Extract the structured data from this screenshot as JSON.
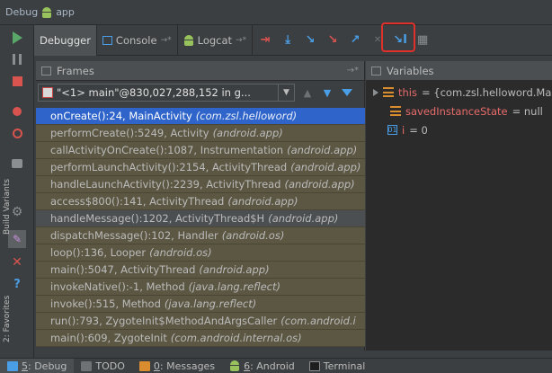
{
  "window": {
    "title": "Debug",
    "app_label": "app"
  },
  "toolbar": {
    "tabs": [
      {
        "label": "Debugger",
        "active": true
      },
      {
        "label": "Console",
        "pin": "→*"
      },
      {
        "label": "Logcat",
        "pin": "→*"
      }
    ],
    "buttons": [
      "show-execution-point-icon",
      "step-over-icon",
      "step-into-icon",
      "force-step-into-icon",
      "step-out-icon",
      "run-to-cursor-icon",
      "evaluate-icon"
    ]
  },
  "frames": {
    "title": "Frames",
    "pin": "→*",
    "thread_selector": "\"<1> main\"@830,027,288,152 in g...",
    "items": [
      {
        "method": "onCreate():24, MainActivity",
        "pkg": "(com.zsl.helloword)",
        "selected": true
      },
      {
        "method": "performCreate():5249, Activity",
        "pkg": "(android.app)"
      },
      {
        "method": "callActivityOnCreate():1087, Instrumentation",
        "pkg": "(android.app)"
      },
      {
        "method": "performLaunchActivity():2154, ActivityThread",
        "pkg": "(android.app)"
      },
      {
        "method": "handleLaunchActivity():2239, ActivityThread",
        "pkg": "(android.app)"
      },
      {
        "method": "access$800():141, ActivityThread",
        "pkg": "(android.app)"
      },
      {
        "method": "handleMessage():1202, ActivityThread$H",
        "pkg": "(android.app)",
        "grey": true
      },
      {
        "method": "dispatchMessage():102, Handler",
        "pkg": "(android.os)"
      },
      {
        "method": "loop():136, Looper",
        "pkg": "(android.os)"
      },
      {
        "method": "main():5047, ActivityThread",
        "pkg": "(android.app)"
      },
      {
        "method": "invokeNative():-1, Method",
        "pkg": "(java.lang.reflect)"
      },
      {
        "method": "invoke():515, Method",
        "pkg": "(java.lang.reflect)"
      },
      {
        "method": "run():793, ZygoteInit$MethodAndArgsCaller",
        "pkg": "(com.android.i"
      },
      {
        "method": "main():609, ZygoteInit",
        "pkg": "(com.android.internal.os)"
      }
    ]
  },
  "variables": {
    "title": "Variables",
    "items": [
      {
        "name": "this",
        "value": "= {com.zsl.helloword.Ma",
        "expandable": true,
        "icon": "object-icon"
      },
      {
        "name": "savedInstanceState",
        "value": "= null",
        "icon": "object-icon"
      },
      {
        "name": "i",
        "value": "= 0",
        "icon": "primitive-icon"
      }
    ]
  },
  "left_strip": {
    "build_variants": "Build Variants",
    "favorites": "2: Favorites"
  },
  "bottom": {
    "tabs": [
      {
        "num": "5",
        "label": ": Debug",
        "active": true
      },
      {
        "num": "",
        "label": "TODO"
      },
      {
        "num": "0",
        "label": ": Messages"
      },
      {
        "num": "6",
        "label": ": Android"
      },
      {
        "num": "",
        "label": "Terminal"
      }
    ]
  }
}
